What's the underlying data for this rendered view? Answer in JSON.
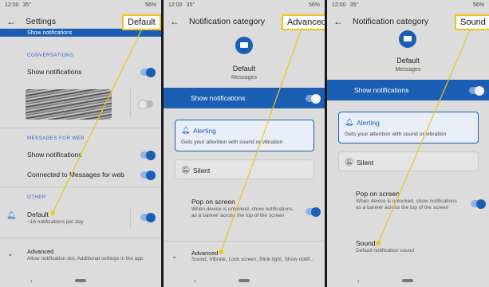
{
  "status": {
    "time": "12:00",
    "temp": "35°",
    "battery": "56%"
  },
  "panel1": {
    "title": "Settings",
    "callout": "Default",
    "top_row": "Show notifications",
    "conversations_header": "CONVERSATIONS",
    "conv_show": "Show notifications",
    "web_header": "MESSAGES FOR WEB",
    "web_show": "Show notifications",
    "web_connected": "Connected to Messages for web",
    "other_header": "OTHER",
    "default_title": "Default",
    "default_sub": "~16 notifications per day",
    "advanced_title": "Advanced",
    "advanced_sub": "Allow notification dot, Additional settings in the app"
  },
  "panel2": {
    "title": "Notification category",
    "callout": "Advanced",
    "channel_name": "Default",
    "channel_sub": "Messages",
    "show_label": "Show notifications",
    "alerting_title": "Alerting",
    "alerting_desc": "Gets your attention with sound or vibration",
    "silent_title": "Silent",
    "pop_title": "Pop on screen",
    "pop_sub": "When device is unlocked, show notifications as a banner across the top of the screen",
    "advanced_title": "Advanced",
    "advanced_sub": "Sound, Vibrate, Lock screen, Blink light, Show notifi..."
  },
  "panel3": {
    "title": "Notification category",
    "callout": "Sound",
    "channel_name": "Default",
    "channel_sub": "Messages",
    "show_label": "Show notifications",
    "alerting_title": "Alerting",
    "alerting_desc": "Gets your attention with sound or vibration",
    "silent_title": "Silent",
    "pop_title": "Pop on screen",
    "pop_sub": "When device is unlocked, show notifications as a banner across the top of the screen",
    "sound_title": "Sound",
    "sound_sub": "Default notification sound"
  },
  "colors": {
    "accent": "#1a5fb4",
    "callout_border": "#f0c419",
    "pointer": "#f0c419"
  }
}
